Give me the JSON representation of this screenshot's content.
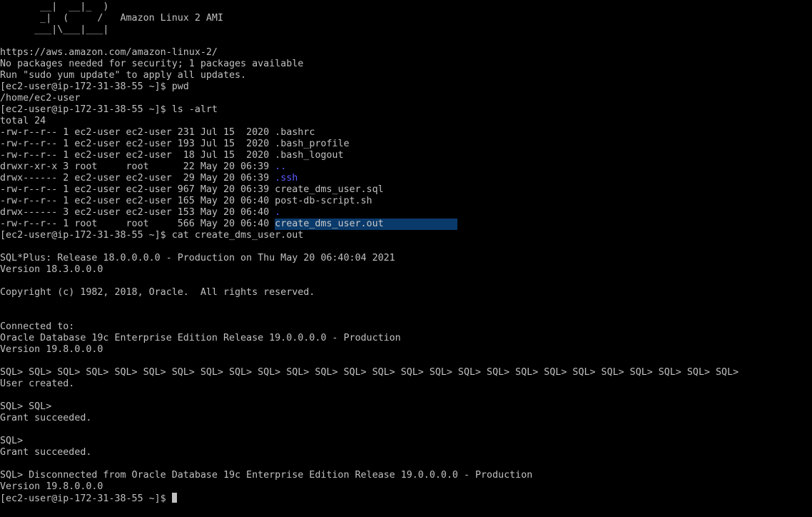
{
  "terminal": {
    "lines": [
      "       __|  __|_  )",
      "       _|  (     /   Amazon Linux 2 AMI",
      "      ___|\\___|___|",
      "",
      "https://aws.amazon.com/amazon-linux-2/",
      "No packages needed for security; 1 packages available",
      "Run \"sudo yum update\" to apply all updates.",
      "[ec2-user@ip-172-31-38-55 ~]$ pwd",
      "/home/ec2-user",
      "[ec2-user@ip-172-31-38-55 ~]$ ls -alrt",
      "total 24"
    ],
    "listing": [
      {
        "meta": "-rw-r--r-- 1 ec2-user ec2-user 231 Jul 15  2020 ",
        "name": ".bashrc",
        "style": "plain"
      },
      {
        "meta": "-rw-r--r-- 1 ec2-user ec2-user 193 Jul 15  2020 ",
        "name": ".bash_profile",
        "style": "plain"
      },
      {
        "meta": "-rw-r--r-- 1 ec2-user ec2-user  18 Jul 15  2020 ",
        "name": ".bash_logout",
        "style": "plain"
      },
      {
        "meta": "drwxr-xr-x 3 root     root      22 May 20 06:39 ",
        "name": "..",
        "style": "dir"
      },
      {
        "meta": "drwx------ 2 ec2-user ec2-user  29 May 20 06:39 ",
        "name": ".ssh",
        "style": "dir"
      },
      {
        "meta": "-rw-r--r-- 1 ec2-user ec2-user 967 May 20 06:39 ",
        "name": "create_dms_user.sql",
        "style": "plain"
      },
      {
        "meta": "-rw-r--r-- 1 ec2-user ec2-user 165 May 20 06:40 ",
        "name": "post-db-script.sh",
        "style": "plain"
      },
      {
        "meta": "drwx------ 3 ec2-user ec2-user 153 May 20 06:40 ",
        "name": ".",
        "style": "dir"
      },
      {
        "meta": "-rw-r--r-- 1 root     root     566 May 20 06:40 ",
        "name": "create_dms_user.out",
        "style": "selected"
      }
    ],
    "after_lines": [
      "[ec2-user@ip-172-31-38-55 ~]$ cat create_dms_user.out",
      "",
      "SQL*Plus: Release 18.0.0.0.0 - Production on Thu May 20 06:40:04 2021",
      "Version 18.3.0.0.0",
      "",
      "Copyright (c) 1982, 2018, Oracle.  All rights reserved.",
      "",
      "",
      "Connected to:",
      "Oracle Database 19c Enterprise Edition Release 19.0.0.0.0 - Production",
      "Version 19.8.0.0.0",
      "",
      "SQL> SQL> SQL> SQL> SQL> SQL> SQL> SQL> SQL> SQL> SQL> SQL> SQL> SQL> SQL> SQL> SQL> SQL> SQL> SQL> SQL> SQL> SQL> SQL> SQL> SQL>",
      "User created.",
      "",
      "SQL> SQL>",
      "Grant succeeded.",
      "",
      "SQL>",
      "Grant succeeded.",
      "",
      "SQL> Disconnected from Oracle Database 19c Enterprise Edition Release 19.0.0.0.0 - Production",
      "Version 19.8.0.0.0"
    ],
    "prompt": "[ec2-user@ip-172-31-38-55 ~]$ ",
    "colors": {
      "background": "#000000",
      "foreground": "#c0c0c0",
      "directory": "#5c5cff",
      "selection": "#0a3a6b"
    }
  }
}
